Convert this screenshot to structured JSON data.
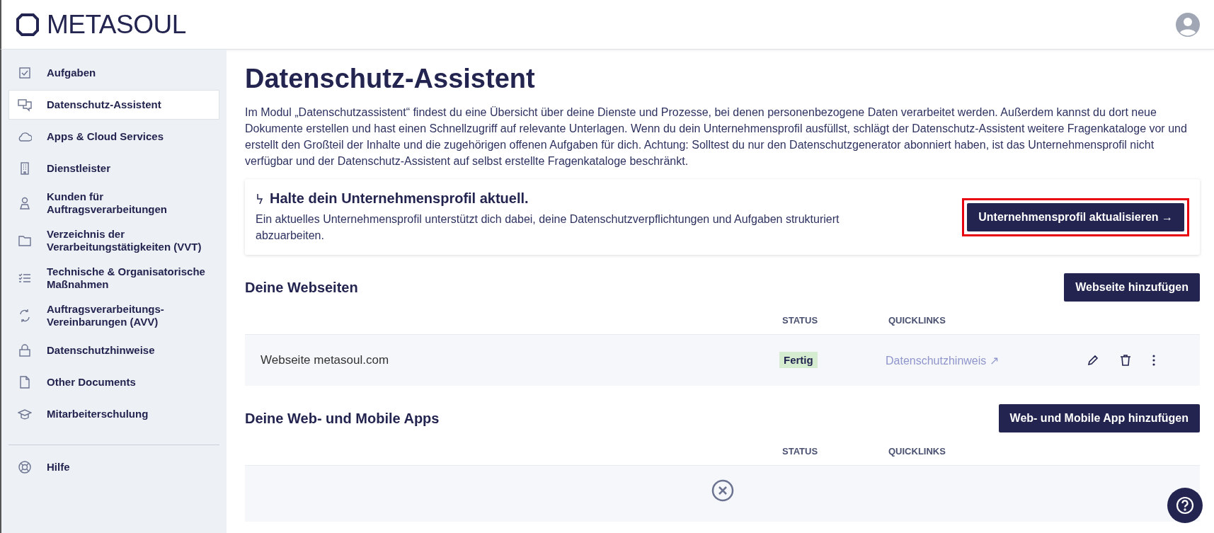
{
  "header": {
    "logo": "METASOUL"
  },
  "sidebar": {
    "items": [
      {
        "label": "Aufgaben",
        "selected": false
      },
      {
        "label": "Datenschutz-Assistent",
        "selected": true
      },
      {
        "label": "Apps & Cloud Services",
        "selected": false
      },
      {
        "label": "Dienstleister",
        "selected": false
      },
      {
        "label": "Kunden für Auftragsverarbeitungen",
        "selected": false
      },
      {
        "label": "Verzeichnis der Verarbeitungstätigkeiten (VVT)",
        "selected": false
      },
      {
        "label": "Technische & Organisatorische Maßnahmen",
        "selected": false
      },
      {
        "label": "Auftragsverarbeitungs-Vereinbarungen (AVV)",
        "selected": false
      },
      {
        "label": "Datenschutzhinweise",
        "selected": false
      },
      {
        "label": "Other Documents",
        "selected": false
      },
      {
        "label": "Mitarbeiterschulung",
        "selected": false
      }
    ],
    "footer_items": [
      {
        "label": "Hilfe",
        "selected": false
      }
    ]
  },
  "page": {
    "title": "Datenschutz-Assistent",
    "intro": "Im Modul „Datenschutzassistent“ findest du eine Übersicht über deine Dienste und Prozesse, bei denen personenbezogene Daten verarbeitet werden. Außerdem kannst du dort neue Dokumente erstellen und hast einen Schnellzugriff auf relevante Unterlagen. Wenn du dein Unternehmensprofil ausfüllst, schlägt der Datenschutz-Assistent weitere Fragenkataloge vor und erstellt den Großteil der Inhalte und die zugehörigen offenen Aufgaben für dich. Achtung: Solltest du nur den Datenschutzgenerator abonniert haben, ist das Unternehmensprofil nicht verfügbar und der Datenschutz-Assistent auf selbst erstellte Fragenkataloge beschränkt.",
    "notice": {
      "title": "Halte dein Unternehmensprofil aktuell.",
      "text": "Ein aktuelles Unternehmensprofil unterstützt dich dabei, deine Datenschutzverpflichtungen und Aufgaben strukturiert abzuarbeiten.",
      "button": "Unternehmensprofil aktualisieren →",
      "highlighted": true
    }
  },
  "sections": [
    {
      "title": "Deine Webseiten",
      "button": "Webseite hinzufügen",
      "columns": [
        "STATUS",
        "QUICKLINKS"
      ],
      "rows": [
        {
          "name": "Webseite metasoul.com",
          "status": "Fertig",
          "quicklink": "Datenschutzhinweis ↗"
        }
      ]
    },
    {
      "title": "Deine Web- und Mobile Apps",
      "button": "Web- und Mobile App hinzufügen",
      "columns": [
        "STATUS",
        "QUICKLINKS"
      ]
    }
  ]
}
